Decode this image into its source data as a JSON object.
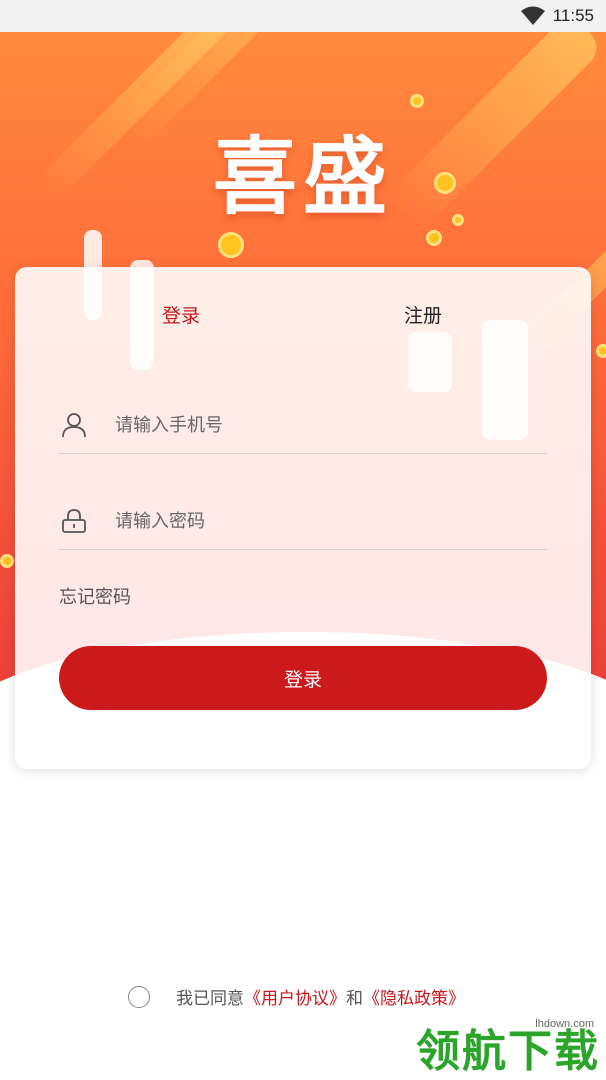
{
  "status_bar": {
    "time": "11:55",
    "wifi_icon": "wifi-icon"
  },
  "brand": {
    "title": "喜盛"
  },
  "tabs": {
    "login": "登录",
    "register": "注册"
  },
  "phone_field": {
    "placeholder": "请输入手机号",
    "value": "",
    "icon": "user-icon"
  },
  "password_field": {
    "placeholder": "请输入密码",
    "value": "",
    "icon": "lock-icon"
  },
  "forgot_password": "忘记密码",
  "login_button": "登录",
  "agreement": {
    "prefix": "我已同意",
    "user_agreement": "《用户协议》",
    "and": "和",
    "privacy_policy": "《隐私政策》"
  },
  "watermark": {
    "url": "lhdown.com",
    "text": "领航下载"
  },
  "colors": {
    "accent": "#cc1a1c",
    "hero_top": "#ff8a3d",
    "hero_bottom": "#e83838",
    "watermark": "#2aa52a"
  }
}
